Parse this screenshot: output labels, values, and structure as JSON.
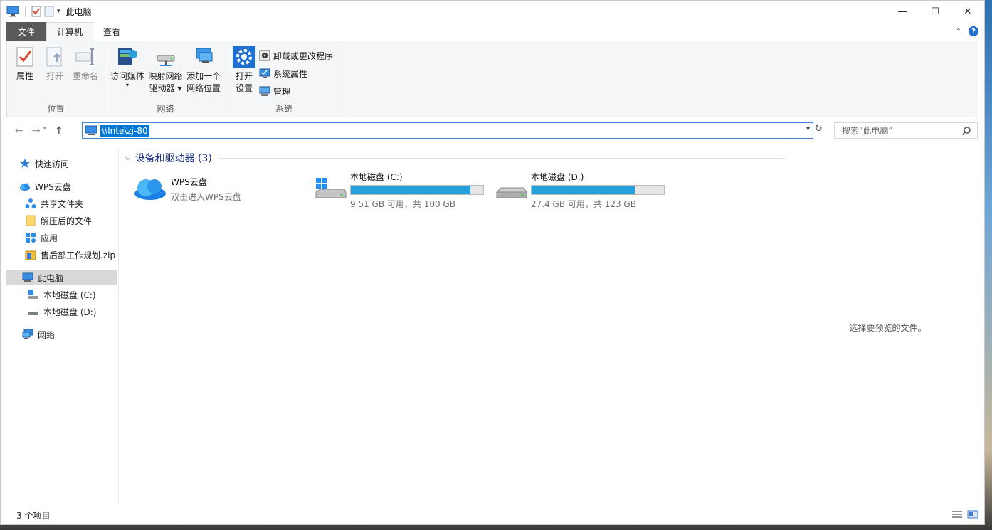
{
  "window": {
    "title": "此电脑",
    "controls": {
      "minimize": "—",
      "maximize": "☐",
      "close": "✕"
    }
  },
  "tabs": [
    {
      "label": "文件"
    },
    {
      "label": "计算机"
    },
    {
      "label": "查看"
    }
  ],
  "ribbon": {
    "groups": {
      "location": "位置",
      "network": "网络",
      "system": "系统"
    },
    "properties": "属性",
    "open": "打开",
    "rename": "重命名",
    "access_media": "访问媒体",
    "map_drive_line1": "映射网络",
    "map_drive_line2": "驱动器 ▾",
    "add_location_line1": "添加一个",
    "add_location_line2": "网络位置",
    "open_settings_line1": "打开",
    "open_settings_line2": "设置",
    "uninstall": "卸载或更改程序",
    "system_properties": "系统属性",
    "manage": "管理"
  },
  "address": {
    "path": "\\\\Inte\\zj-80",
    "search_placeholder": "搜索\"此电脑\""
  },
  "nav": {
    "quick_access": "快速访问",
    "wps_cloud": "WPS云盘",
    "shared_folder": "共享文件夹",
    "extracted_files": "解压后的文件",
    "apps": "应用",
    "zip_file": "售后部工作规划.zip",
    "this_pc": "此电脑",
    "drive_c": "本地磁盘 (C:)",
    "drive_d": "本地磁盘 (D:)",
    "network": "网络"
  },
  "content": {
    "section_title": "设备和驱动器 (3)",
    "items": [
      {
        "name": "WPS云盘",
        "sub": "双击进入WPS云盘"
      },
      {
        "name": "本地磁盘 (C:)",
        "sub": "9.51 GB 可用，共 100 GB",
        "used_fraction": 0.905
      },
      {
        "name": "本地磁盘 (D:)",
        "sub": "27.4 GB 可用，共 123 GB",
        "used_fraction": 0.777
      }
    ]
  },
  "preview": {
    "text": "选择要预览的文件。"
  },
  "status": {
    "count": "3 个项目"
  },
  "colors": {
    "accent": "#0078d7",
    "bar_fill": "#26a0da",
    "file_tab": "#595959"
  }
}
